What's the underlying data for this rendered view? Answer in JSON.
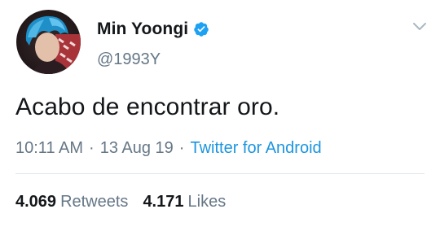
{
  "author": {
    "display_name": "Min Yoongi",
    "handle": "@1993Y",
    "verified": true,
    "avatar_icon": "profile-photo-blue-hair"
  },
  "tweet": {
    "text": "Acabo de encontrar oro.",
    "time": "10:11 AM",
    "separator": "·",
    "date": "13 Aug 19",
    "source": "Twitter for Android"
  },
  "stats": {
    "retweets_count": "4.069",
    "retweets_label": "Retweets",
    "likes_count": "4.171",
    "likes_label": "Likes"
  },
  "icons": {
    "verified": "verified-badge-icon",
    "menu": "chevron-down-icon"
  },
  "colors": {
    "text_primary": "#14171a",
    "text_secondary": "#657786",
    "link": "#1b95e0",
    "verified": "#1da1f2",
    "divider": "#e1e8ed"
  }
}
